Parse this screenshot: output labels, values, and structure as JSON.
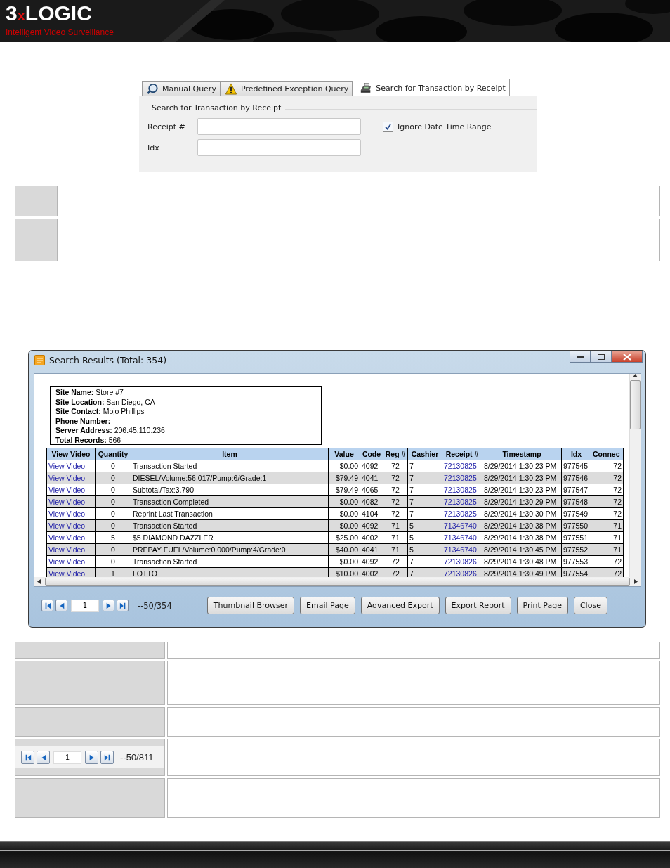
{
  "header": {
    "logo": {
      "lead": "3",
      "mark": "x",
      "rest": "LOGIC"
    },
    "tagline": "Intelligent Video Surveillance"
  },
  "query_panel": {
    "tabs": [
      {
        "label": "Manual Query",
        "selected": false
      },
      {
        "label": "Predefined Exception Query",
        "selected": false
      },
      {
        "label": "Search for Transaction by Receipt",
        "selected": true
      }
    ],
    "group_title": "Search for Transaction by Receipt",
    "fields": [
      {
        "label": "Receipt #"
      },
      {
        "label": "Idx"
      }
    ],
    "checkbox": {
      "label": "Ignore Date Time Range",
      "checked": true
    }
  },
  "results_window": {
    "title": "Search Results (Total: 354)",
    "site_info": [
      {
        "label": "Site Name:",
        "value": "Store #7"
      },
      {
        "label": "Site Location:",
        "value": "San Diego, CA"
      },
      {
        "label": "Site Contact:",
        "value": "Mojo Phillips"
      },
      {
        "label": "Phone Number:"
      },
      {
        "label": "Server Address:",
        "value": "206.45.110.236"
      },
      {
        "label": "Total Records:",
        "value": "566"
      }
    ],
    "columns": [
      {
        "label": "View Video",
        "kind": "link"
      },
      {
        "label": "Quantity",
        "kind": "text"
      },
      {
        "label": "Item",
        "kind": "text"
      },
      {
        "label": "Value",
        "kind": "text"
      },
      {
        "label": "Code",
        "kind": "text"
      },
      {
        "label": "Reg #",
        "kind": "text"
      },
      {
        "label": "Cashier",
        "kind": "text"
      },
      {
        "label": "Receipt #",
        "kind": "link"
      },
      {
        "label": "Timestamp",
        "kind": "text"
      },
      {
        "label": "Idx",
        "kind": "text"
      },
      {
        "label": "Connec",
        "kind": "text"
      }
    ],
    "rows": [
      [
        "View Video",
        "0",
        "Transaction Started",
        "$0.00",
        "4092",
        "72",
        "7",
        "72130825",
        "8/29/2014 1:30:23 PM",
        "977545",
        "72"
      ],
      [
        "View Video",
        "0",
        "DIESEL/Volume:56.017/Pump:6/Grade:1",
        "$79.49",
        "4041",
        "72",
        "7",
        "72130825",
        "8/29/2014 1:30:23 PM",
        "977546",
        "72"
      ],
      [
        "View Video",
        "0",
        "Subtotal/Tax:3.790",
        "$79.49",
        "4065",
        "72",
        "7",
        "72130825",
        "8/29/2014 1:30:23 PM",
        "977547",
        "72"
      ],
      [
        "View Video",
        "0",
        "Transaction Completed",
        "$0.00",
        "4082",
        "72",
        "7",
        "72130825",
        "8/29/2014 1:30:29 PM",
        "977548",
        "72"
      ],
      [
        "View Video",
        "0",
        "Reprint Last Transaction",
        "$0.00",
        "4104",
        "72",
        "7",
        "72130825",
        "8/29/2014 1:30:30 PM",
        "977549",
        "72"
      ],
      [
        "View Video",
        "0",
        "Transaction Started",
        "$0.00",
        "4092",
        "71",
        "5",
        "71346740",
        "8/29/2014 1:30:38 PM",
        "977550",
        "71"
      ],
      [
        "View Video",
        "5",
        "$5 DIAMOND DAZZLER",
        "$25.00",
        "4002",
        "71",
        "5",
        "71346740",
        "8/29/2014 1:30:38 PM",
        "977551",
        "71"
      ],
      [
        "View Video",
        "0",
        "PREPAY FUEL/Volume:0.000/Pump:4/Grade:0",
        "$40.00",
        "4041",
        "71",
        "5",
        "71346740",
        "8/29/2014 1:30:45 PM",
        "977552",
        "71"
      ],
      [
        "View Video",
        "0",
        "Transaction Started",
        "$0.00",
        "4092",
        "72",
        "7",
        "72130826",
        "8/29/2014 1:30:48 PM",
        "977553",
        "72"
      ],
      [
        "View Video",
        "1",
        "LOTTO",
        "$10.00",
        "4002",
        "72",
        "7",
        "72130826",
        "8/29/2014 1:30:49 PM",
        "977554",
        "72"
      ]
    ],
    "pager": {
      "page": "1",
      "range": "--50/354"
    },
    "buttons": [
      "Thumbnail Browser",
      "Email Page",
      "Advanced Export",
      "Export Report",
      "Print Page",
      "Close"
    ]
  },
  "doc_table": {
    "pager": {
      "page": "1",
      "range": "--50/811"
    }
  }
}
